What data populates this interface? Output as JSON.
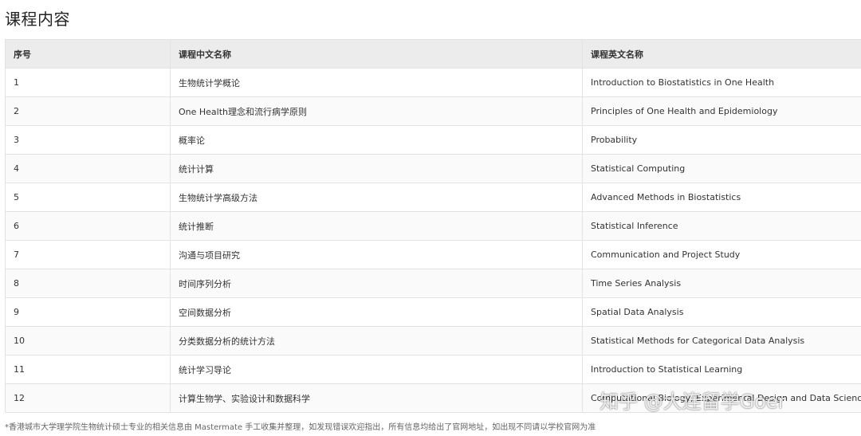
{
  "title": "课程内容",
  "table": {
    "headers": [
      "序号",
      "课程中文名称",
      "课程英文名称"
    ],
    "rows": [
      [
        "1",
        "生物统计学概论",
        "Introduction to Biostatistics in One Health"
      ],
      [
        "2",
        "One Health理念和流行病学原则",
        "Principles of One Health and Epidemiology"
      ],
      [
        "3",
        "概率论",
        "Probability"
      ],
      [
        "4",
        "统计计算",
        "Statistical Computing"
      ],
      [
        "5",
        "生物统计学高级方法",
        "Advanced Methods in Biostatistics"
      ],
      [
        "6",
        "统计推断",
        "Statistical Inference"
      ],
      [
        "7",
        "沟通与项目研究",
        "Communication and Project Study"
      ],
      [
        "8",
        "时间序列分析",
        "Time Series Analysis"
      ],
      [
        "9",
        "空间数据分析",
        "Spatial Data Analysis"
      ],
      [
        "10",
        "分类数据分析的统计方法",
        "Statistical Methods for Categorical Data Analysis"
      ],
      [
        "11",
        "统计学习导论",
        "Introduction to Statistical Learning"
      ],
      [
        "12",
        "计算生物学、实验设计和数据科学",
        "Computational Biology, Experimental Design and Data Science"
      ]
    ]
  },
  "footnote": "*香港城市大学理学院生物统计硕士专业的相关信息由 Mastermate 手工收集并整理，如发现错误欢迎指出，所有信息均给出了官网地址，如出现不同请以学校官网为准",
  "watermark": "知乎 @大连留学Goer"
}
